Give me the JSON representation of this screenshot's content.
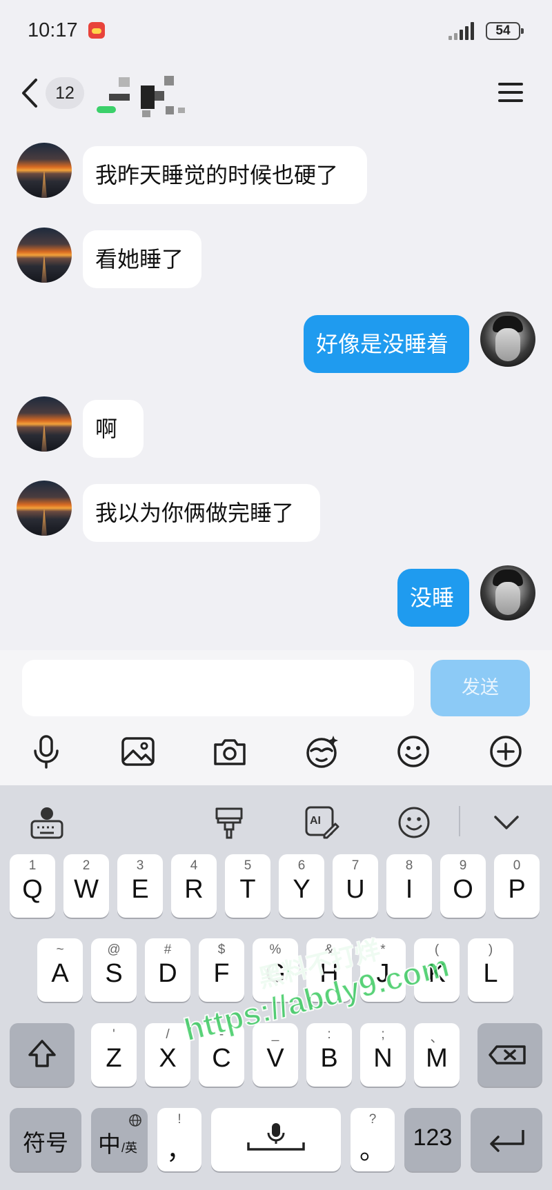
{
  "status_bar": {
    "time": "10:17",
    "battery": "54"
  },
  "header": {
    "unread_count": "12"
  },
  "messages": [
    {
      "side": "in",
      "text": "我昨天睡觉的时候也硬了"
    },
    {
      "side": "in",
      "text": "看她睡了"
    },
    {
      "side": "out",
      "text": "好像是没睡着"
    },
    {
      "side": "in",
      "text": "啊"
    },
    {
      "side": "in",
      "text": "我以为你俩做完睡了"
    },
    {
      "side": "out",
      "text": "没睡"
    }
  ],
  "composer": {
    "input_value": "",
    "send_label": "发送"
  },
  "toolbar_icons": [
    "microphone-icon",
    "image-icon",
    "camera-icon",
    "sticker-icon",
    "emoji-icon",
    "plus-icon"
  ],
  "keyboard": {
    "toolbar_icons": [
      "keyboard-globe-icon",
      "brush-icon",
      "ai-pen-icon",
      "emoji-icon",
      "chevron-down-icon"
    ],
    "row1": [
      {
        "main": "Q",
        "sub": "1"
      },
      {
        "main": "W",
        "sub": "2"
      },
      {
        "main": "E",
        "sub": "3"
      },
      {
        "main": "R",
        "sub": "4"
      },
      {
        "main": "T",
        "sub": "5"
      },
      {
        "main": "Y",
        "sub": "6"
      },
      {
        "main": "U",
        "sub": "7"
      },
      {
        "main": "I",
        "sub": "8"
      },
      {
        "main": "O",
        "sub": "9"
      },
      {
        "main": "P",
        "sub": "0"
      }
    ],
    "row2": [
      {
        "main": "A",
        "sub": "~"
      },
      {
        "main": "S",
        "sub": "@"
      },
      {
        "main": "D",
        "sub": "#"
      },
      {
        "main": "F",
        "sub": "$"
      },
      {
        "main": "G",
        "sub": "%"
      },
      {
        "main": "H",
        "sub": "&"
      },
      {
        "main": "J",
        "sub": "*"
      },
      {
        "main": "K",
        "sub": "("
      },
      {
        "main": "L",
        "sub": ")"
      }
    ],
    "row3": [
      {
        "main": "Z",
        "sub": "'"
      },
      {
        "main": "X",
        "sub": "/"
      },
      {
        "main": "C",
        "sub": "-"
      },
      {
        "main": "V",
        "sub": "_"
      },
      {
        "main": "B",
        "sub": ":"
      },
      {
        "main": "N",
        "sub": ";"
      },
      {
        "main": "M",
        "sub": "、"
      }
    ],
    "symbols_label": "符号",
    "lang_main": "中",
    "lang_sub": "/英",
    "comma_main": "，",
    "comma_sub": "!",
    "period_main": "。",
    "period_sub": "?",
    "numbers_label": "123"
  },
  "watermark": {
    "line1": "黑料不打烊",
    "line2": "https://abdy9.com"
  }
}
